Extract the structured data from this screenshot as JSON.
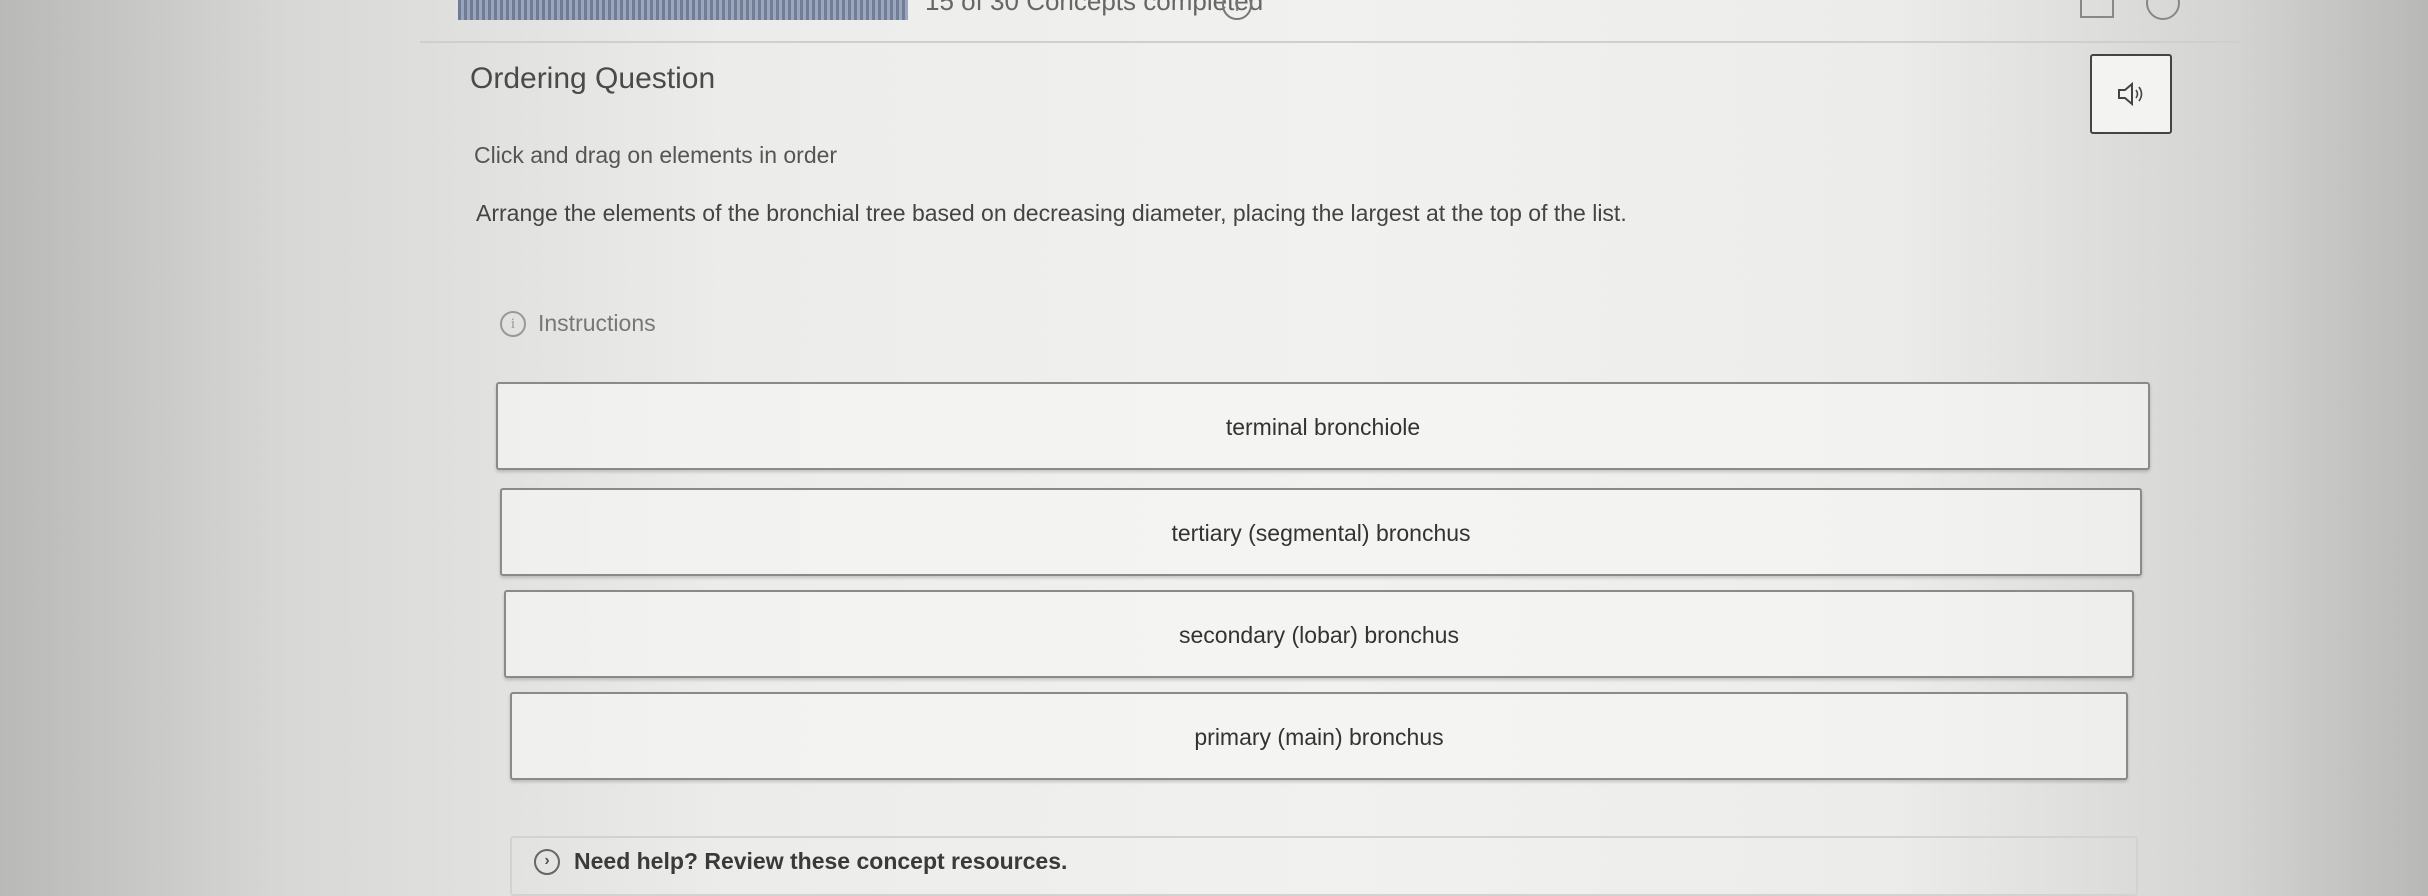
{
  "header": {
    "progress_text": "15 of 30 Concepts completed"
  },
  "question": {
    "title": "Ordering Question",
    "subtitle": "Click and drag on elements in order",
    "prompt": "Arrange the elements of the bronchial tree based on decreasing diameter, placing the largest at the top of the list.",
    "instructions_label": "Instructions"
  },
  "items": [
    {
      "label": "terminal bronchiole"
    },
    {
      "label": "tertiary (segmental) bronchus"
    },
    {
      "label": "secondary (lobar) bronchus"
    },
    {
      "label": "primary (main) bronchus"
    }
  ],
  "help": {
    "label": "Need help? Review these concept resources."
  },
  "icons": {
    "audio": "speaker-icon",
    "info": "info-icon",
    "help_toggle": "chevron-right-icon"
  }
}
